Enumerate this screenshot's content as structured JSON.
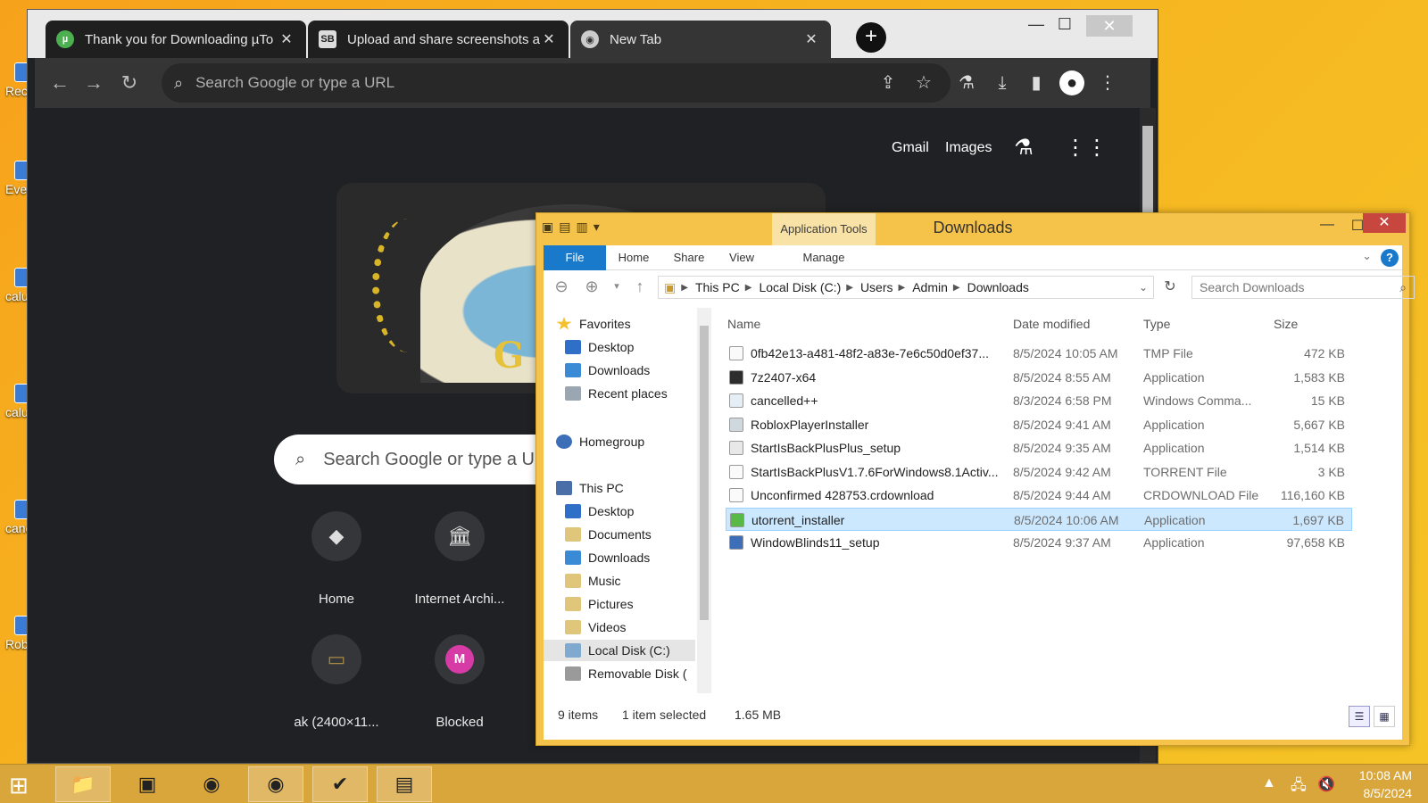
{
  "desktop": {
    "icons": [
      {
        "label": "Rec",
        "icon": "recycle-bin-icon"
      },
      {
        "label": "Eve",
        "icon": "app-icon"
      },
      {
        "label": "calu",
        "icon": "file-icon"
      },
      {
        "label": "calu",
        "icon": "file-icon"
      },
      {
        "label": "canc - S",
        "icon": "file-icon"
      },
      {
        "label": "Rob",
        "icon": "roblox-icon"
      }
    ]
  },
  "chrome": {
    "tabs": [
      {
        "title": "Thank you for Downloading µTo",
        "favicon": "utorrent-favicon",
        "active": false
      },
      {
        "title": "Upload and share screenshots a",
        "favicon": "screenshot-favicon",
        "favicon_text": "SB",
        "active": false
      },
      {
        "title": "New Tab",
        "favicon": "chrome-favicon",
        "active": true
      }
    ],
    "new_tab_label": "+",
    "omnibox_placeholder": "Search Google or type a URL",
    "top_links": {
      "gmail": "Gmail",
      "images": "Images"
    },
    "search_placeholder": "Search Google or type a URL",
    "doodle_text": "G",
    "shortcuts": [
      {
        "label": "Home",
        "glyph": "◆"
      },
      {
        "label": "Internet Archi...",
        "glyph": "🏛"
      },
      {
        "label": "ak (2400×11...",
        "glyph": "▭"
      },
      {
        "label": "Blocked",
        "glyph": "M"
      }
    ]
  },
  "explorer": {
    "caption": "Downloads",
    "app_tools": "Application Tools",
    "ribbon_tabs": [
      "File",
      "Home",
      "Share",
      "View",
      "Manage"
    ],
    "breadcrumb": [
      "This PC",
      "Local Disk (C:)",
      "Users",
      "Admin",
      "Downloads"
    ],
    "search_placeholder": "Search Downloads",
    "nav": {
      "favorites": "Favorites",
      "fav_items": [
        "Desktop",
        "Downloads",
        "Recent places"
      ],
      "homegroup": "Homegroup",
      "this_pc": "This PC",
      "pc_items": [
        "Desktop",
        "Documents",
        "Downloads",
        "Music",
        "Pictures",
        "Videos",
        "Local Disk (C:)",
        "Removable Disk ("
      ]
    },
    "columns": {
      "name": "Name",
      "date": "Date modified",
      "type": "Type",
      "size": "Size"
    },
    "files": [
      {
        "name": "0fb42e13-a481-48f2-a83e-7e6c50d0ef37...",
        "date": "8/5/2024 10:05 AM",
        "type": "TMP File",
        "size": "472 KB",
        "selected": false
      },
      {
        "name": "7z2407-x64",
        "date": "8/5/2024 8:55 AM",
        "type": "Application",
        "size": "1,583 KB",
        "selected": false
      },
      {
        "name": "cancelled++",
        "date": "8/3/2024 6:58 PM",
        "type": "Windows Comma...",
        "size": "15 KB",
        "selected": false
      },
      {
        "name": "RobloxPlayerInstaller",
        "date": "8/5/2024 9:41 AM",
        "type": "Application",
        "size": "5,667 KB",
        "selected": false
      },
      {
        "name": "StartIsBackPlusPlus_setup",
        "date": "8/5/2024 9:35 AM",
        "type": "Application",
        "size": "1,514 KB",
        "selected": false
      },
      {
        "name": "StartIsBackPlusV1.7.6ForWindows8.1Activ...",
        "date": "8/5/2024 9:42 AM",
        "type": "TORRENT File",
        "size": "3 KB",
        "selected": false
      },
      {
        "name": "Unconfirmed 428753.crdownload",
        "date": "8/5/2024 9:44 AM",
        "type": "CRDOWNLOAD File",
        "size": "116,160 KB",
        "selected": false
      },
      {
        "name": "utorrent_installer",
        "date": "8/5/2024 10:06 AM",
        "type": "Application",
        "size": "1,697 KB",
        "selected": true
      },
      {
        "name": "WindowBlinds11_setup",
        "date": "8/5/2024 9:37 AM",
        "type": "Application",
        "size": "97,658 KB",
        "selected": false
      }
    ],
    "status": {
      "count": "9 items",
      "selection": "1 item selected",
      "size": "1.65 MB"
    }
  },
  "taskbar": {
    "apps": [
      "file-explorer-icon",
      "app-window-icon",
      "chrome-icon",
      "chrome-alt-icon",
      "checklist-icon",
      "monitor-icon"
    ],
    "time": "10:08 AM",
    "date": "8/5/2024"
  },
  "colors": {
    "desktop_bg": "#f6b31f",
    "chrome_bg": "#202124",
    "explorer_frame": "#f6c34a",
    "selection": "#cce8ff",
    "accent": "#1979ca"
  }
}
